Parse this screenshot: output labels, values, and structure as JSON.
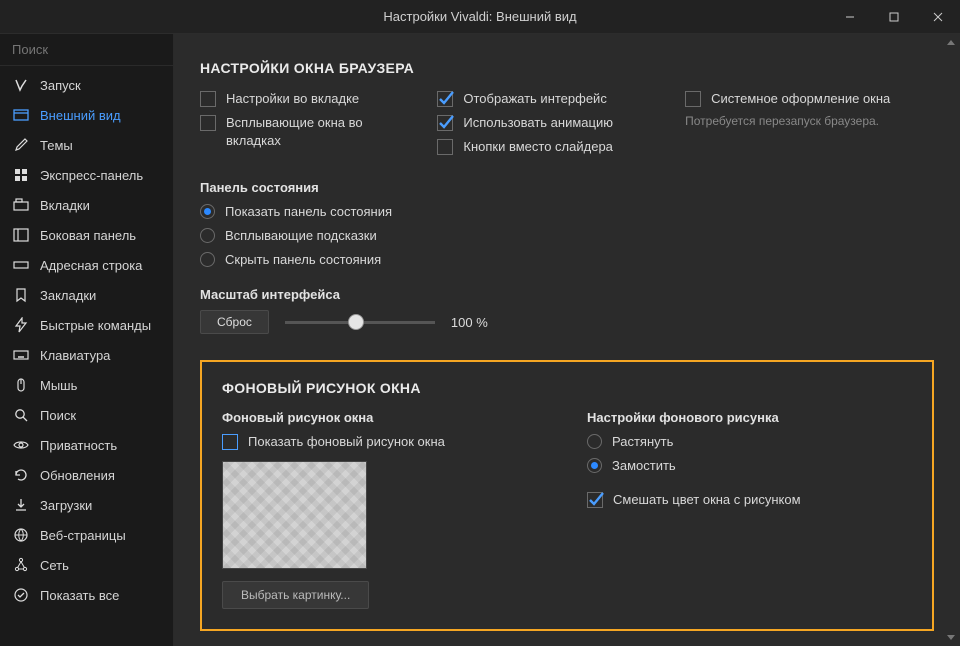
{
  "window": {
    "title": "Настройки Vivaldi: Внешний вид"
  },
  "search": {
    "placeholder": "Поиск"
  },
  "sidebar": {
    "items": [
      {
        "label": "Запуск"
      },
      {
        "label": "Внешний вид"
      },
      {
        "label": "Темы"
      },
      {
        "label": "Экспресс-панель"
      },
      {
        "label": "Вкладки"
      },
      {
        "label": "Боковая панель"
      },
      {
        "label": "Адресная строка"
      },
      {
        "label": "Закладки"
      },
      {
        "label": "Быстрые команды"
      },
      {
        "label": "Клавиатура"
      },
      {
        "label": "Мышь"
      },
      {
        "label": "Поиск"
      },
      {
        "label": "Приватность"
      },
      {
        "label": "Обновления"
      },
      {
        "label": "Загрузки"
      },
      {
        "label": "Веб-страницы"
      },
      {
        "label": "Сеть"
      },
      {
        "label": "Показать все"
      }
    ]
  },
  "browser_window": {
    "title": "НАСТРОЙКИ ОКНА БРАУЗЕРА",
    "col1": {
      "settings_in_tab": "Настройки во вкладке",
      "popups_in_tabs": "Всплывающие окна во вкладках"
    },
    "col2": {
      "show_ui": "Отображать интерфейс",
      "use_animation": "Использовать анимацию",
      "buttons_instead_slider": "Кнопки вместо слайдера"
    },
    "col3": {
      "system_chrome": "Системное оформление окна",
      "restart_note": "Потребуется перезапуск браузера."
    },
    "status_panel": {
      "header": "Панель состояния",
      "show": "Показать панель состояния",
      "popups": "Всплывающие подсказки",
      "hide": "Скрыть панель состояния"
    },
    "scale": {
      "header": "Масштаб интерфейса",
      "reset": "Сброс",
      "value": "100 %"
    }
  },
  "bg_image": {
    "title": "ФОНОВЫЙ РИСУНОК ОКНА",
    "left": {
      "header": "Фоновый рисунок окна",
      "show": "Показать фоновый рисунок окна",
      "choose": "Выбрать картинку..."
    },
    "right": {
      "header": "Настройки фонового рисунка",
      "stretch": "Растянуть",
      "tile": "Замостить",
      "blend": "Смешать цвет окна с рисунком"
    }
  }
}
